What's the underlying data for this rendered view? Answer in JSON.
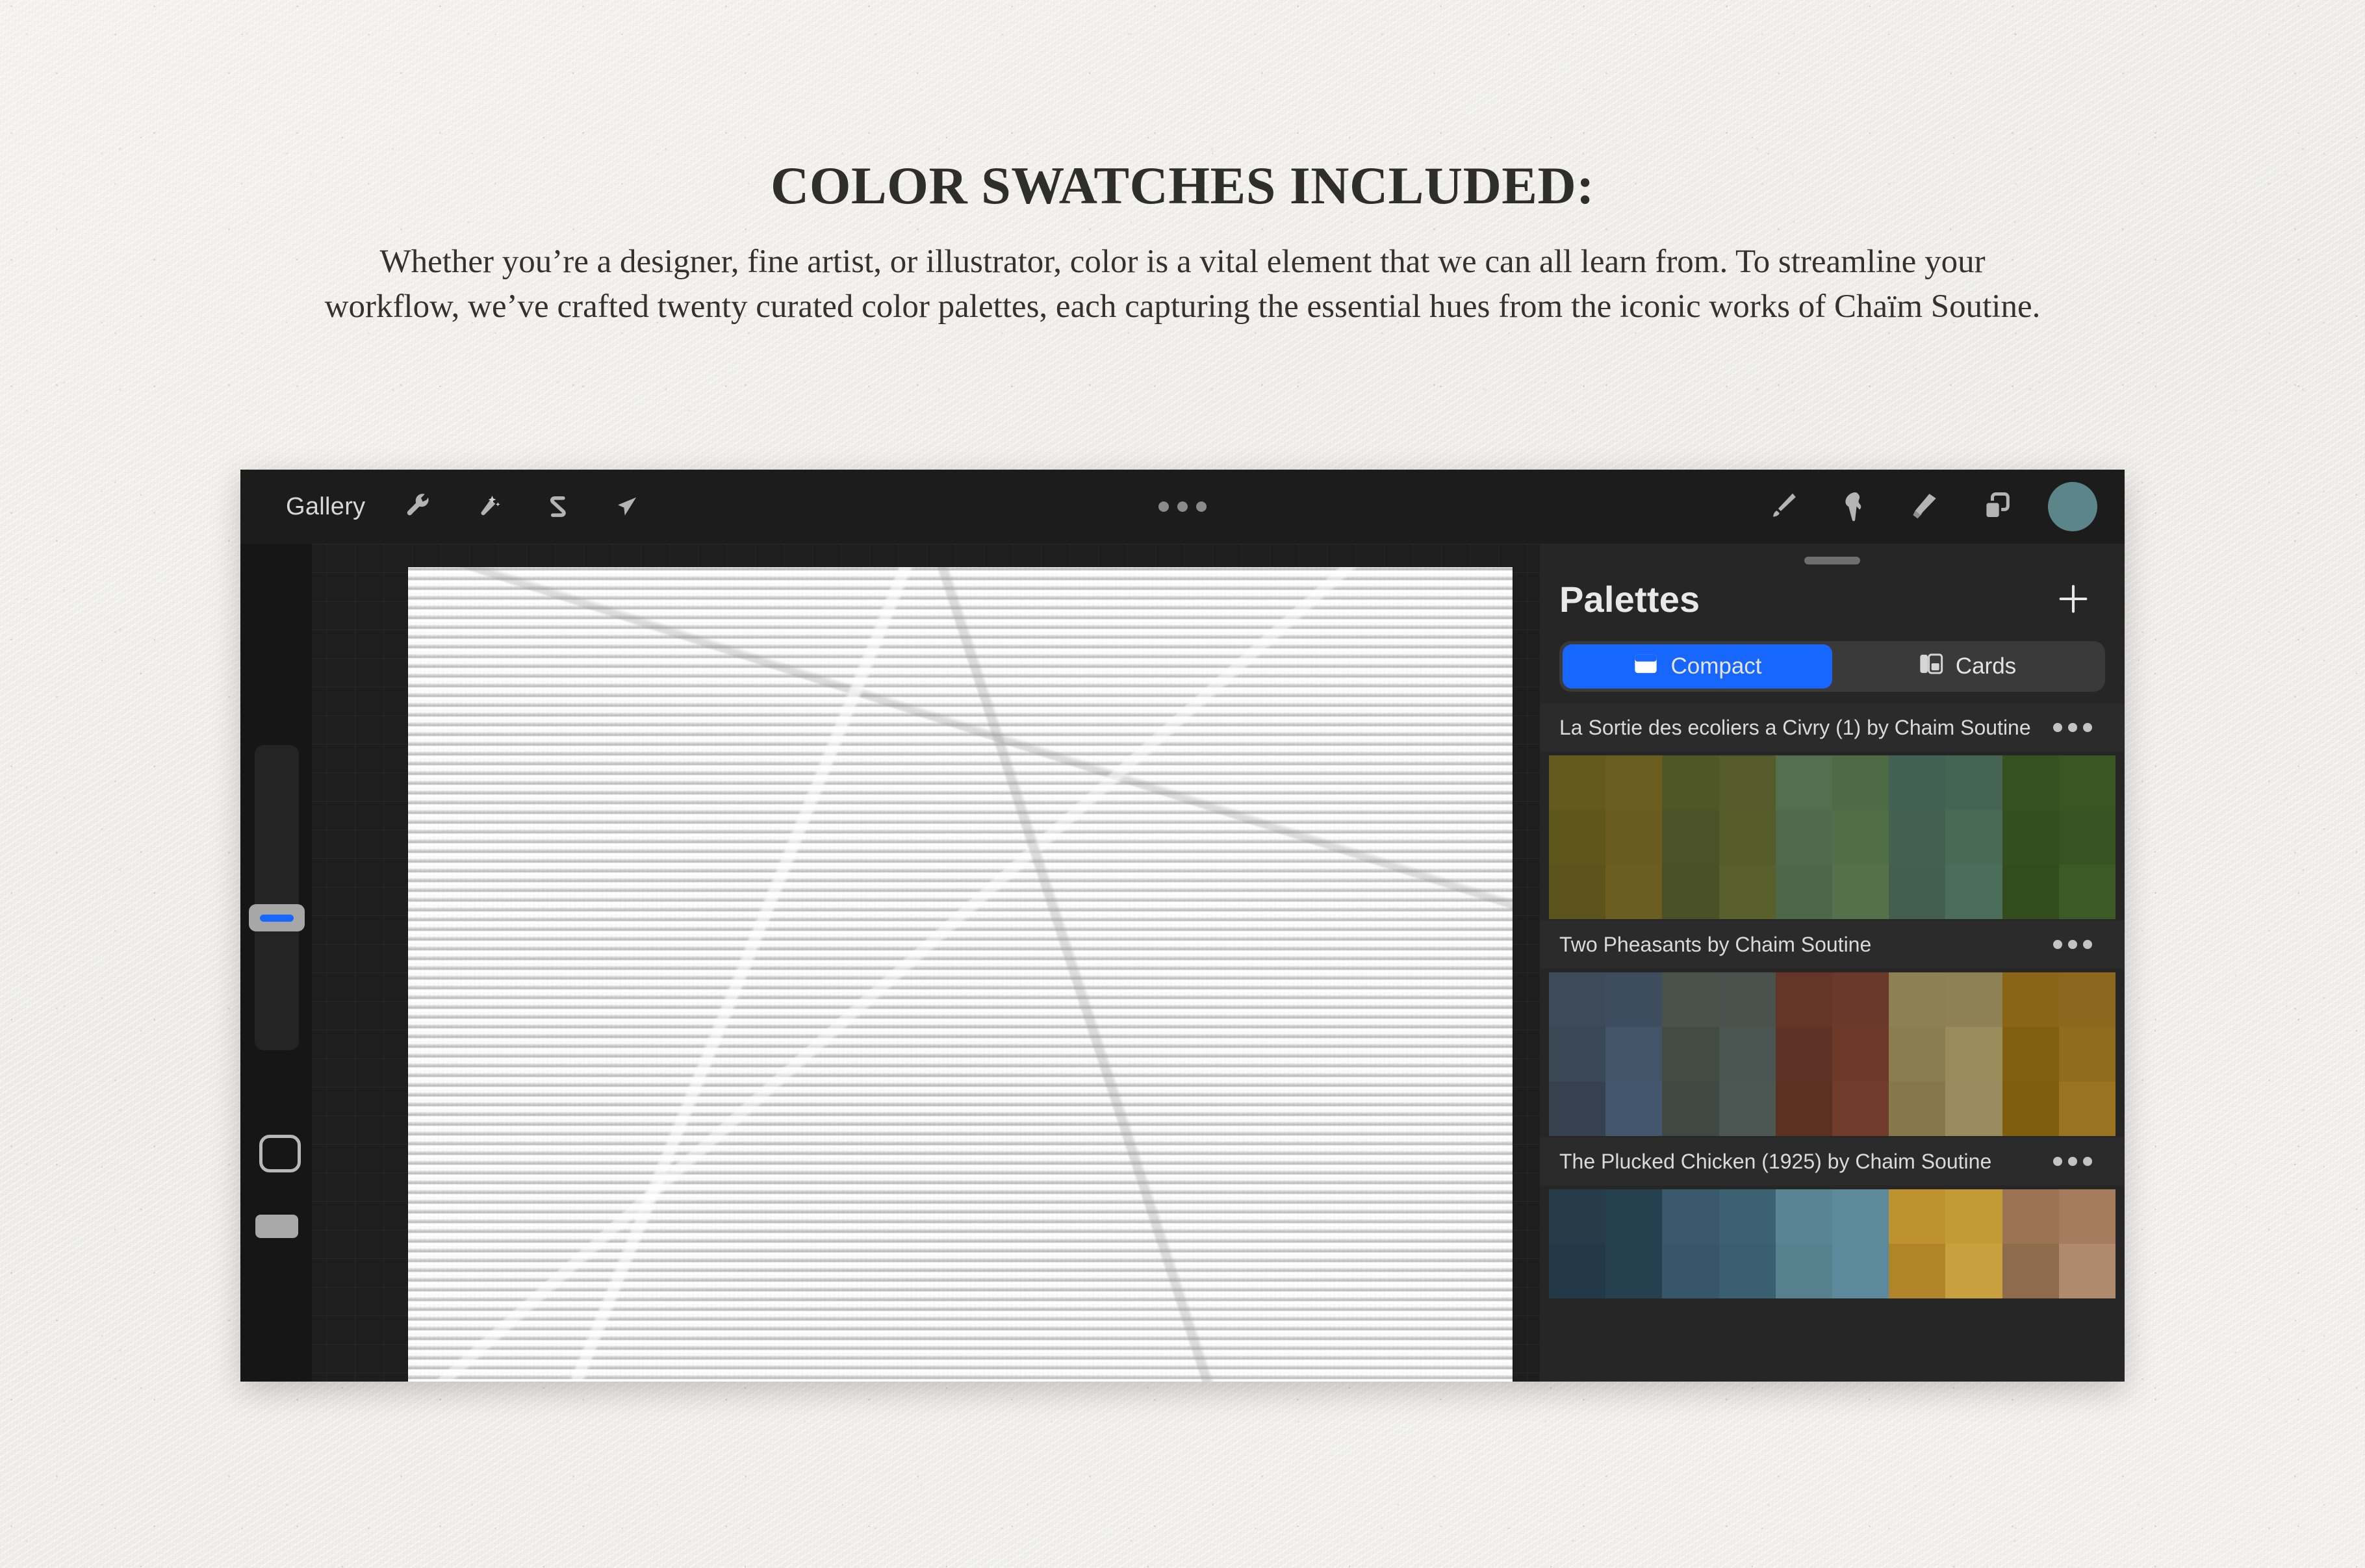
{
  "promo": {
    "headline": "COLOR SWATCHES INCLUDED:",
    "body": "Whether you’re a designer, fine artist, or illustrator, color is a vital element that we can all learn from. To streamline your workflow, we’ve crafted twenty curated color palettes, each capturing the essential hues from the iconic works of Chaïm Soutine."
  },
  "app": {
    "toolbar": {
      "gallery_label": "Gallery",
      "left_tools": [
        {
          "name": "wrench-icon",
          "label": "Actions"
        },
        {
          "name": "magic-wand-icon",
          "label": "Adjustments"
        },
        {
          "name": "selection-icon",
          "label": "Selection"
        },
        {
          "name": "transform-arrow-icon",
          "label": "Transform"
        }
      ],
      "center_menu": "canvas-menu-dots",
      "right_tools": [
        {
          "name": "paintbrush-icon",
          "label": "Paint"
        },
        {
          "name": "smudge-icon",
          "label": "Smudge"
        },
        {
          "name": "eraser-icon",
          "label": "Erase"
        },
        {
          "name": "layers-icon",
          "label": "Layers"
        }
      ],
      "color_swatch": "#5b8589"
    },
    "sidebar": {
      "size_slider_fill": "#1767ff",
      "handle_color": "#a7a7a7"
    },
    "palettes": {
      "title": "Palettes",
      "add_button_label": "+",
      "view_modes": [
        {
          "label": "Compact",
          "icon": "compact-view-icon",
          "active": true
        },
        {
          "label": "Cards",
          "icon": "cards-view-icon",
          "active": false
        }
      ],
      "accent_color": "#1767ff",
      "items": [
        {
          "name": "La Sortie des ecoliers a Civry (1) by Chaim Soutine",
          "more_label": "•••",
          "colors": [
            "#645a1e",
            "#6b5c1f",
            "#4f5628",
            "#555b2a",
            "#546f4e",
            "#4e6b47",
            "#436152",
            "#466454",
            "#375220",
            "#3a5623",
            "#5f561c",
            "#6a5c1f",
            "#4b5227",
            "#565c29",
            "#51694c",
            "#506e48",
            "#44604f",
            "#4a6a56",
            "#344f1f",
            "#385322",
            "#5d541b",
            "#6c5e20",
            "#4a5126",
            "#5a602c",
            "#4e664a",
            "#54714b",
            "#435f4e",
            "#4c6d59",
            "#324c1e",
            "#3c5a26"
          ]
        },
        {
          "name": "Two Pheasants by Chaim Soutine",
          "more_label": "•••",
          "colors": [
            "#3d4a5a",
            "#3e4c60",
            "#4a5348",
            "#49524d",
            "#66352a",
            "#6b382c",
            "#8d8052",
            "#8e8255",
            "#8a6517",
            "#8b681d",
            "#3a4755",
            "#435469",
            "#434b42",
            "#4a5450",
            "#5e3226",
            "#6d3a2a",
            "#8a7d50",
            "#9a8a5c",
            "#80600f",
            "#906c1f",
            "#36414f",
            "#44566d",
            "#414842",
            "#4c5753",
            "#5b3124",
            "#713c2c",
            "#86784b",
            "#9c8b5f",
            "#7e5f10",
            "#9a7322"
          ]
        },
        {
          "name": "The Plucked Chicken (1925) by Chaim Soutine",
          "more_label": "•••",
          "colors": [
            "#273c49",
            "#25404f",
            "#39596b",
            "#3b6173",
            "#5a8491",
            "#5c8a9b",
            "#bf9230",
            "#c29a36",
            "#9b7352",
            "#a47b5d",
            "#233947",
            "#27404f",
            "#375669",
            "#3a5f71",
            "#56808c",
            "#5c8a9c",
            "#b08529",
            "#c9a040",
            "#8f6b4d",
            "#b08a6c"
          ]
        }
      ]
    }
  }
}
